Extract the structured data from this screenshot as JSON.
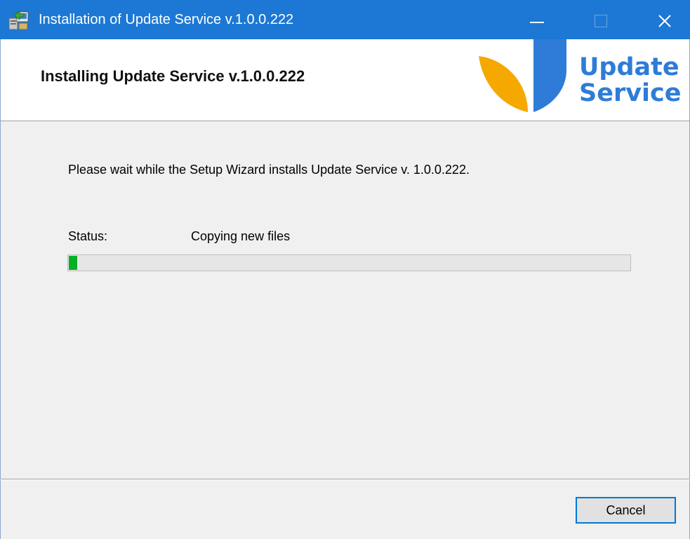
{
  "window": {
    "title": "Installation of Update Service v.1.0.0.222",
    "accent_color": "#1c78d4"
  },
  "titlebar": {
    "icon": "installer-icon",
    "minimize_icon": "minimize-icon",
    "maximize_icon": "maximize-icon",
    "close_icon": "close-icon"
  },
  "header": {
    "title": "Installing Update Service v.1.0.0.222",
    "logo": {
      "line1": "Update",
      "line2": "Service",
      "leaf_color": "#f5a800",
      "shield_color": "#2e7cd8"
    }
  },
  "main": {
    "message": "Please wait while the Setup Wizard installs Update Service v. 1.0.0.222.",
    "status_label": "Status:",
    "status_value": "Copying new files",
    "progress_percent": 1.5,
    "progress_color": "#06b025"
  },
  "footer": {
    "cancel_label": "Cancel"
  }
}
